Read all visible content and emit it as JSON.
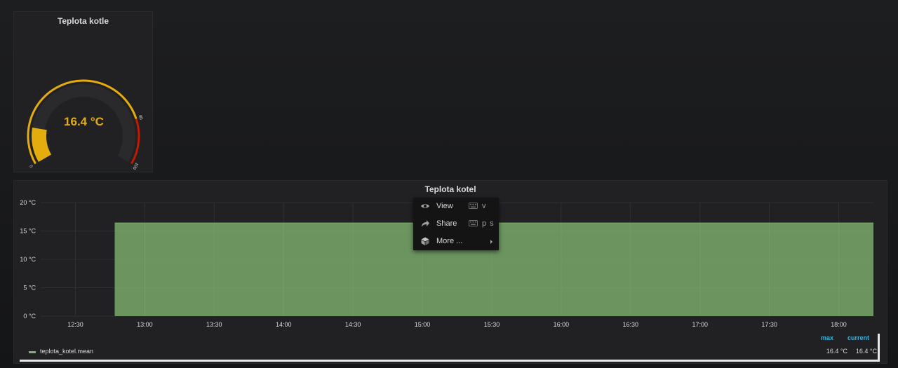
{
  "gauge": {
    "title": "Teplota kotle",
    "value_text": "16.4 °C",
    "value": 16.4,
    "min": 0,
    "max": 100,
    "threshold": 80,
    "tick_labels": [
      "0",
      "80",
      "100"
    ],
    "colors": {
      "value": "#e5ac0e",
      "ok_band": "#e5ac0e",
      "warn_band": "#bf1b00",
      "track": "#2a2a2c"
    }
  },
  "graph": {
    "title": "Teplota kotel",
    "legend": {
      "header_max": "max",
      "header_current": "current",
      "series_name": "teplota_kotel.mean",
      "max_text": "16.4 °C",
      "current_text": "16.4 °C"
    }
  },
  "context_menu": {
    "items": [
      {
        "label": "View",
        "icon": "eye-icon",
        "shortcut": "v"
      },
      {
        "label": "Share",
        "icon": "share-icon",
        "shortcut": "p s"
      },
      {
        "label": "More ...",
        "icon": "cube-icon",
        "shortcut": ""
      }
    ]
  },
  "chart_data": {
    "type": "area",
    "title": "Teplota kotel",
    "xlabel": "",
    "ylabel": "",
    "x_ticks": [
      "12:30",
      "13:00",
      "13:30",
      "14:00",
      "14:30",
      "15:00",
      "15:30",
      "16:00",
      "16:30",
      "17:00",
      "17:30",
      "18:00"
    ],
    "y_ticks": [
      "0 °C",
      "5 °C",
      "10 °C",
      "15 °C",
      "20 °C"
    ],
    "ylim": [
      0,
      20
    ],
    "xlim": [
      "12:15",
      "18:15"
    ],
    "grid": true,
    "legend_position": "bottom",
    "series": [
      {
        "name": "teplota_kotel.mean",
        "color": "#7eb26d",
        "x": [
          "12:47",
          "18:15"
        ],
        "y": [
          16.4,
          16.4
        ]
      }
    ]
  }
}
